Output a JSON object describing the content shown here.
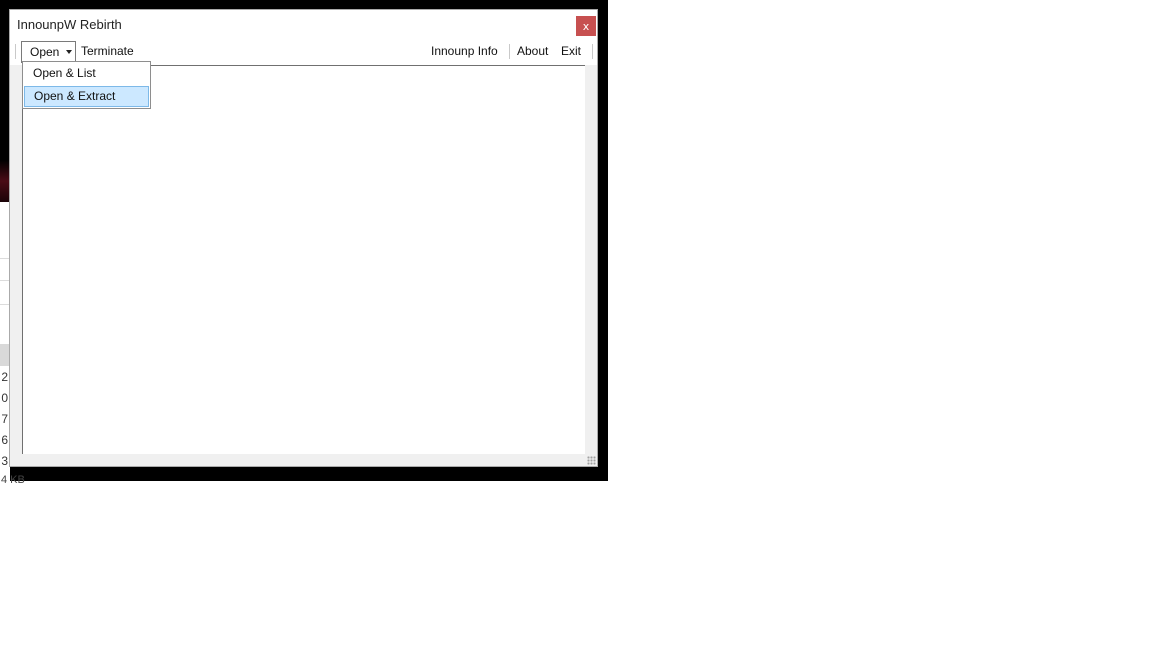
{
  "window": {
    "title": "InnounpW Rebirth",
    "close_glyph": "x"
  },
  "menu": {
    "open_label": "Open",
    "terminate_label": "Terminate",
    "info_label": "Innounp Info",
    "about_label": "About",
    "exit_label": "Exit"
  },
  "dropdown": {
    "items": [
      {
        "label": "Open & List"
      },
      {
        "label": "Open & Extract",
        "highlighted": true
      }
    ]
  },
  "background": {
    "partial_numbers": [
      "2",
      "0",
      "7",
      "6",
      "3"
    ],
    "partial_size": "4 KB"
  },
  "colors": {
    "close_button": "#c75050",
    "highlight": "#cce8ff",
    "highlight_border": "#7db9e8"
  }
}
